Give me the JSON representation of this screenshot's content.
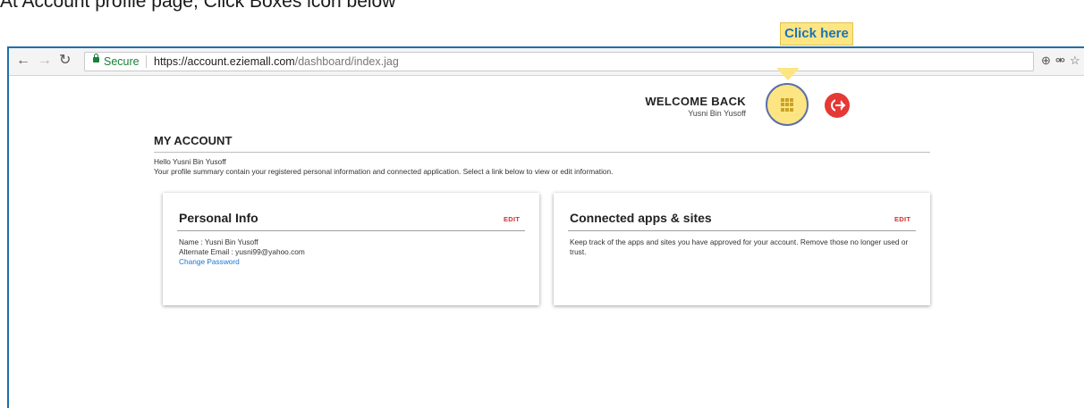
{
  "instruction": "At Account profile page, Click Boxes icon below",
  "browser": {
    "url_secure_label": "Secure",
    "url_domain": "https://account.eziemall.com",
    "url_path": "/dashboard/index.jag",
    "back_icon": "back-arrow-icon",
    "forward_icon": "forward-arrow-icon",
    "reload_icon": "reload-icon"
  },
  "callout": {
    "label": "Click here"
  },
  "header": {
    "welcome_title": "WELCOME BACK",
    "user_name": "Yusni Bin Yusoff",
    "apps_icon": "grid-boxes-icon",
    "logout_icon": "logout-icon"
  },
  "account": {
    "title": "MY ACCOUNT",
    "hello": "Hello Yusni Bin Yusoff",
    "summary": "Your profile summary contain your registered personal information and connected application. Select a link below to view or edit information."
  },
  "personal_info": {
    "title": "Personal Info",
    "edit_label": "EDIT",
    "name_line": "Name : Yusni Bin Yusoff",
    "email_line": "Alternate Email : yusni99@yahoo.com",
    "change_password": "Change Password"
  },
  "connected_apps": {
    "title": "Connected apps & sites",
    "edit_label": "EDIT",
    "description_1": "Keep track of the apps and sites you have approved for your account. Remove those no longer used or",
    "description_2": "trust."
  },
  "colors": {
    "accent_yellow": "#fde583",
    "link_blue": "#1976d2",
    "edit_red": "#d32f2f",
    "logout_red": "#e53935",
    "secure_green": "#188038"
  }
}
